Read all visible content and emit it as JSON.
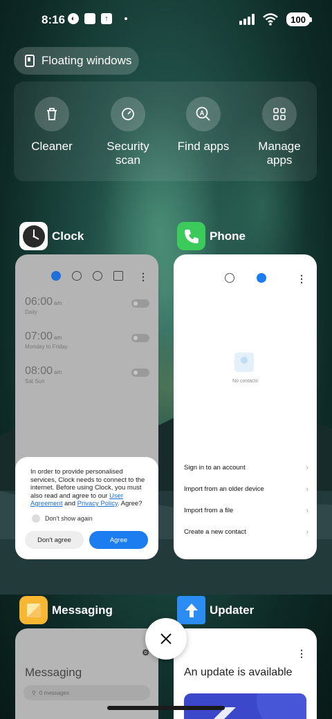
{
  "status_bar": {
    "time": "8:16",
    "battery": "100"
  },
  "floating_windows": {
    "label": "Floating windows"
  },
  "tools": [
    {
      "label": "Cleaner",
      "icon": "trash-icon"
    },
    {
      "label": "Security\nscan",
      "icon": "gauge-icon"
    },
    {
      "label": "Find apps",
      "icon": "search-app-icon"
    },
    {
      "label": "Manage\napps",
      "icon": "grid-icon"
    }
  ],
  "apps": {
    "clock": {
      "title": "Clock",
      "alarms": [
        {
          "time": "06:00",
          "ampm": "am",
          "repeat": "Daily"
        },
        {
          "time": "07:00",
          "ampm": "am",
          "repeat": "Monday to Friday"
        },
        {
          "time": "08:00",
          "ampm": "am",
          "repeat": "Sat Sun"
        }
      ],
      "consent": {
        "text_before": "In order to provide personalised services, Clock needs to connect to the internet. Before using Clock, you must also read and agree to our ",
        "link1": "User Agreement",
        "mid": " and ",
        "link2": "Privacy Policy",
        "after": ". Agree?",
        "checkbox_label": "Don't show again",
        "disagree": "Don't agree",
        "agree": "Agree"
      }
    },
    "phone": {
      "title": "Phone",
      "empty_text": "No contacts",
      "actions": [
        "Sign in to an account",
        "Import from an older device",
        "Import from a file",
        "Create a new contact"
      ]
    },
    "messaging": {
      "title": "Messaging",
      "heading": "Messaging",
      "search_placeholder": "0 messages"
    },
    "updater": {
      "title": "Updater",
      "heading": "An update is available"
    }
  },
  "colors": {
    "accent": "#1c7df0",
    "phone_icon": "#3ccb5a",
    "updater_icon": "#2b8cf3",
    "messaging_icon": "#f7b733"
  }
}
